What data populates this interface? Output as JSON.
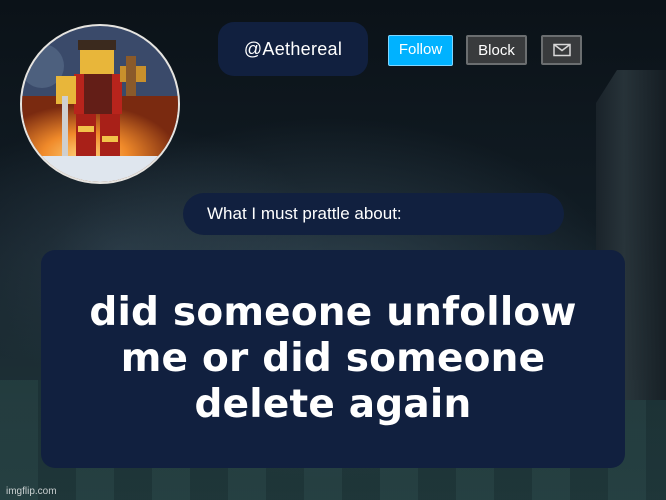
{
  "profile": {
    "username": "@Aethereal",
    "avatar_icon": "roblox-avatar-image"
  },
  "actions": {
    "follow_label": "Follow",
    "block_label": "Block",
    "message_icon": "mail-icon"
  },
  "about": {
    "heading": "What I must prattle about:",
    "body": "did someone unfollow me or did someone delete again"
  },
  "watermark": "imgflip.com",
  "colors": {
    "panel": "#11203f",
    "follow": "#00b2ff",
    "button_dark": "#393b3d"
  }
}
